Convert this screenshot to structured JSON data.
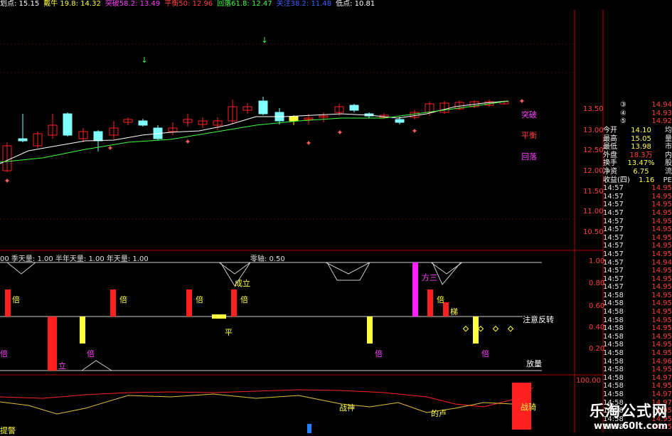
{
  "topbar": [
    {
      "label": "划点: 15.15",
      "color": "#ffffff"
    },
    {
      "label": "戴牛 19.8: 14.32",
      "color": "#ffff40"
    },
    {
      "label": "突破58.2: 13.49",
      "color": "#ff40ff"
    },
    {
      "label": "平衡50: 12.96",
      "color": "#ff4040"
    },
    {
      "label": "回落61.8: 12.47",
      "color": "#40ff40"
    },
    {
      "label": "关注38.2: 11.48",
      "color": "#4060ff"
    },
    {
      "label": "低点: 10.81",
      "color": "#ffffff"
    }
  ],
  "price_axis": [
    "13.50",
    "13.00",
    "12.50",
    "12.00",
    "11.50",
    "11.00",
    "10.50"
  ],
  "price_labels": [
    {
      "text": "突破",
      "color": "#ff40ff"
    },
    {
      "text": "平衡",
      "color": "#ff4040"
    },
    {
      "text": "回落",
      "color": "#ff40ff"
    }
  ],
  "indicator_header": {
    "text": "00 季天量: 1.00  半年天量: 1.00  年天量: 1.00",
    "zero": "零轴: 0.50"
  },
  "indicator_axis": [
    "1.00",
    "0.80",
    "0.60",
    "0.40",
    "0.20"
  ],
  "indicator_labels": {
    "attention": "注意反转",
    "volume": "放量",
    "bei": "倍",
    "cheng_li": "成立",
    "ping": "平",
    "fang_san": "方三",
    "ti": "梯",
    "li": "立"
  },
  "bottom_labels": {
    "zhan_shen": "战神",
    "de_lu": "的卢",
    "zhan_ma": "战骑",
    "bottom_left": "提警"
  },
  "bottom_axis": "100.00",
  "side_marks": [
    {
      "num": "③",
      "price": "14.94"
    },
    {
      "num": "④",
      "price": "14.93"
    },
    {
      "num": "⑤",
      "price": "14.92"
    }
  ],
  "stats": [
    {
      "label": "今开",
      "value": "14.10",
      "unit": "均"
    },
    {
      "label": "最高",
      "value": "15.05",
      "unit": "量"
    },
    {
      "label": "最低",
      "value": "13.98",
      "unit": "市"
    },
    {
      "label": "外盘",
      "value": "18.3万",
      "unit": "内"
    },
    {
      "label": "换手",
      "value": "13.47%",
      "unit": "股"
    },
    {
      "label": "净资",
      "value": "6.75",
      "unit": "流"
    },
    {
      "label": "收益(四)",
      "value": "1.16",
      "unit": "PE"
    }
  ],
  "ticks": [
    [
      "14:57",
      "14.95"
    ],
    [
      "14:57",
      "14.95"
    ],
    [
      "14:57",
      "14.95"
    ],
    [
      "14:57",
      "14.95"
    ],
    [
      "14:57",
      "14.95"
    ],
    [
      "14:57",
      "14.95"
    ],
    [
      "14:57",
      "14.95"
    ],
    [
      "14:57",
      "14.95"
    ],
    [
      "14:57",
      "14.95"
    ],
    [
      "14:57",
      "14.94"
    ],
    [
      "14:57",
      "14.95"
    ],
    [
      "14:57",
      "14.95"
    ],
    [
      "14:57",
      "14.95"
    ],
    [
      "14:58",
      "14.95"
    ],
    [
      "14:58",
      "14.95"
    ],
    [
      "14:58",
      "14.95"
    ],
    [
      "14:58",
      "14.95"
    ],
    [
      "14:58",
      "14.95"
    ],
    [
      "14:58",
      "14.95"
    ],
    [
      "14:58",
      "14.95"
    ],
    [
      "14:58",
      "14.95"
    ],
    [
      "14:58",
      "14.96"
    ],
    [
      "14:58",
      "14.95"
    ],
    [
      "14:58",
      "14.97"
    ],
    [
      "14:58",
      "14.95"
    ],
    [
      "14:58",
      "14.97"
    ],
    [
      "14:58",
      "14.97"
    ],
    [
      "14:58",
      "14.95"
    ],
    [
      "14:58",
      "14.95"
    ],
    [
      "14:58",
      "14.95"
    ]
  ],
  "logo": {
    "name": "乐淘公式网",
    "url": "www.60lt.com"
  }
}
